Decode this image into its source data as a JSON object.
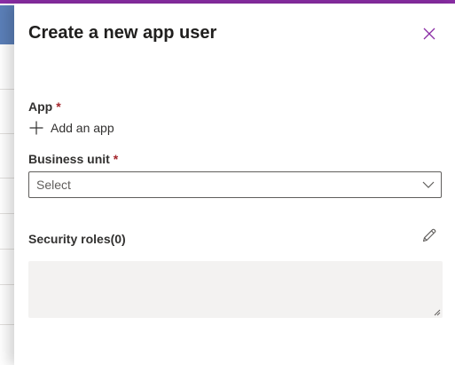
{
  "dialog": {
    "title": "Create a new app user"
  },
  "form": {
    "app_label": "App",
    "app_required_mark": "*",
    "add_app_label": "Add an app",
    "business_unit_label": "Business unit",
    "business_unit_required_mark": "*",
    "business_unit_value": "Select",
    "security_roles_label": "Security roles(0)"
  },
  "icons": {
    "close": "close-icon",
    "add": "plus-icon",
    "dropdown": "chevron-down-icon",
    "edit": "pencil-icon",
    "resize": "resize-grip-icon"
  },
  "colors": {
    "accent": "#8a2da5",
    "required": "#a4262c",
    "background_tile": "#5b7fb8"
  }
}
